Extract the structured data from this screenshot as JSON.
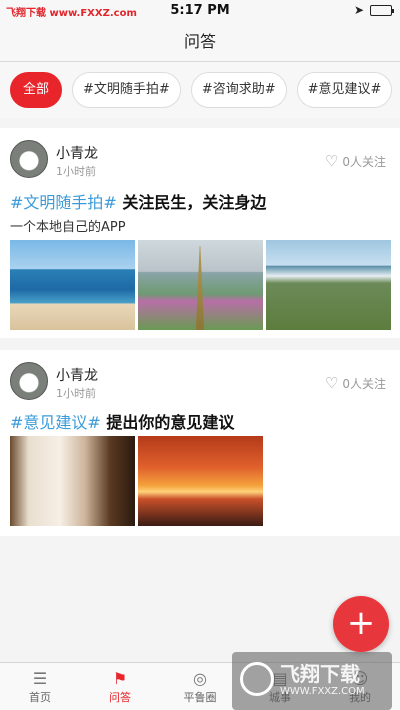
{
  "status_bar": {
    "left_text": "飞翔下载 www.FXXZ.com",
    "time": "5:17 PM"
  },
  "nav": {
    "title": "问答"
  },
  "filters": [
    "全部",
    "#文明随手拍#",
    "#咨询求助#",
    "#意见建议#"
  ],
  "posts": [
    {
      "user": "小青龙",
      "time": "1小时前",
      "follow": "0人关注",
      "tag": "#文明随手拍#",
      "title": "关注民生，关注身边",
      "subtitle": "一个本地自己的APP"
    },
    {
      "user": "小青龙",
      "time": "1小时前",
      "follow": "0人关注",
      "tag": "#意见建议#",
      "title": "提出你的意见建议"
    }
  ],
  "fab_label": "+",
  "tabs": [
    "首页",
    "问答",
    "平鲁圈",
    "城事",
    "我的"
  ],
  "watermark": {
    "main": "飞翔下载",
    "url": "WWW.FXXZ.COM"
  },
  "colors": {
    "accent": "#e8252b",
    "tag": "#3b9bd8"
  }
}
